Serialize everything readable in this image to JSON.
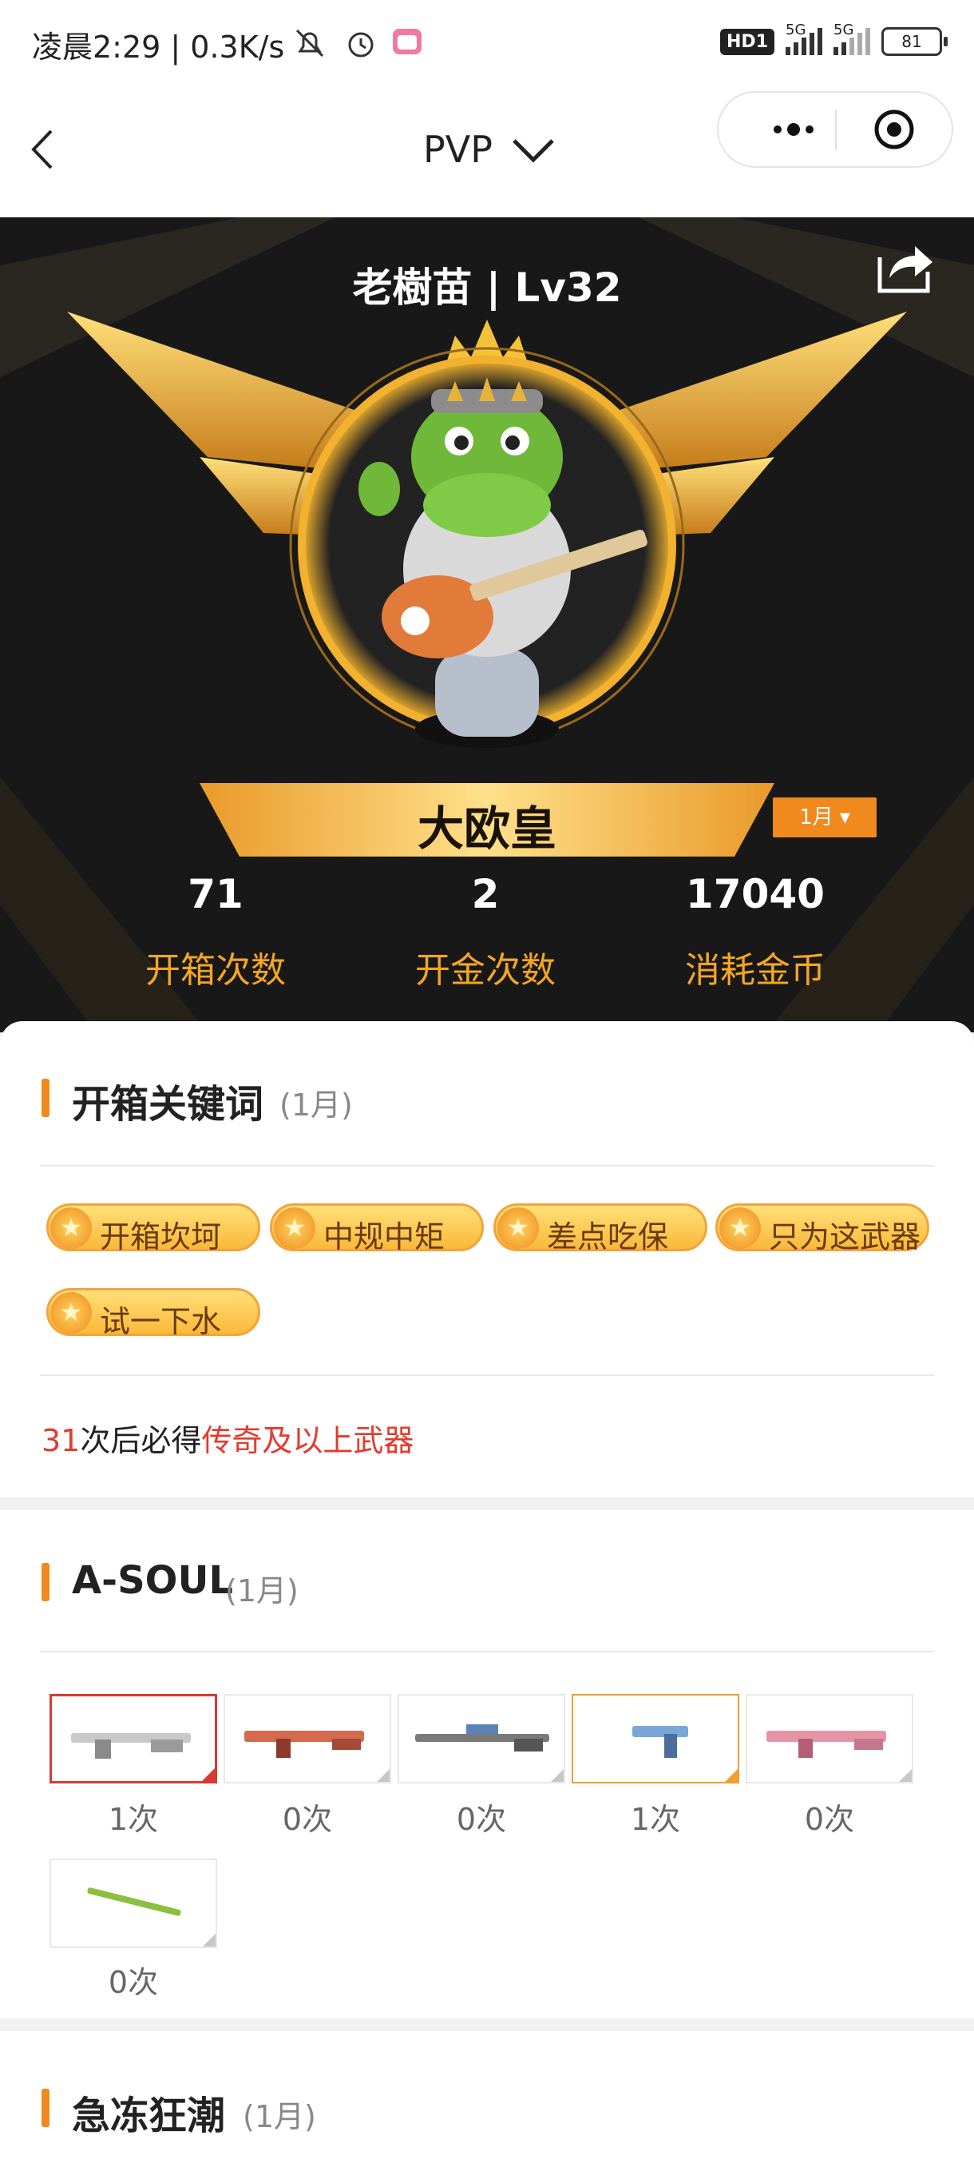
{
  "status_bar": {
    "time": "凌晨2:29 | 0.3K/s",
    "hd_badge": "HD1",
    "signal1": "5G",
    "signal2": "5G",
    "battery": "81"
  },
  "nav": {
    "title": "PVP"
  },
  "profile": {
    "name_level": "老樹苗 | Lv32",
    "rank_title": "大欧皇",
    "month_selector": "1月 ▾",
    "stats": [
      {
        "value": "71",
        "label": "开箱次数"
      },
      {
        "value": "2",
        "label": "开金次数"
      },
      {
        "value": "17040",
        "label": "消耗金币"
      }
    ]
  },
  "keywords": {
    "title": "开箱关键词",
    "period": "(1月)",
    "tags": [
      "开箱坎坷",
      "中规中矩",
      "差点吃保",
      "只为这武器",
      "试一下水"
    ],
    "guarantee_count": "31",
    "guarantee_mid": "次后必得",
    "guarantee_red": "传奇及以上武器"
  },
  "asoul": {
    "title": "A-SOUL",
    "period": "(1月)",
    "items": [
      {
        "count": "1次",
        "color": "#c9c9c9"
      },
      {
        "count": "0次",
        "color": "#d56a4e"
      },
      {
        "count": "0次",
        "color": "#7a7a7a"
      },
      {
        "count": "1次",
        "color": "#7aa6d6"
      },
      {
        "count": "0次",
        "color": "#e793a6"
      },
      {
        "count": "0次",
        "color": "#8cbf3f"
      }
    ]
  },
  "frost": {
    "title": "急冻狂潮",
    "period": "(1月)"
  }
}
